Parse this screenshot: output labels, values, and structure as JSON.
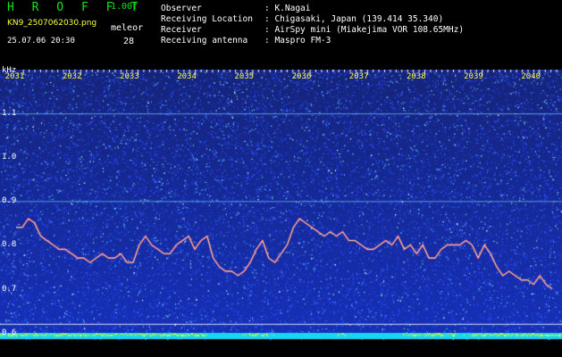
{
  "header": {
    "logo": "H R O F F T",
    "version": "1.00f",
    "filename": "KN9_2507062030.png",
    "timestamp": "25.07.06 20:30",
    "source_label": "meleor",
    "count": "28",
    "meta": [
      {
        "key": "Observer",
        "value": ": K.Nagai"
      },
      {
        "key": "Receiving Location",
        "value": ": Chigasaki, Japan (139.414 35.340)"
      },
      {
        "key": "Receiver",
        "value": ": AirSpy mini (Miakejima VOR 108.65MHz)"
      },
      {
        "key": "Receiving antenna",
        "value": ": Maspro FM-3"
      }
    ]
  },
  "colors": {
    "logo": "#13e51a",
    "file": "#ffff3c",
    "noise": "#1a2fc8",
    "trace": "#ff4e9a",
    "bar": "#ffff00",
    "base": "#17d6f2"
  },
  "chart_data": {
    "type": "heatmap",
    "ylabel": "kHz",
    "y_ticks": [
      "1.1",
      "1.0",
      "0.9",
      "0.8",
      "0.7",
      "0.6"
    ],
    "y_tick_values": [
      1.1,
      1.0,
      0.9,
      0.8,
      0.7,
      0.6
    ],
    "ylim": [
      0.585,
      1.2
    ],
    "x_ticks": [
      "2031",
      "2032",
      "2033",
      "2034",
      "2035",
      "2036",
      "2037",
      "2038",
      "2039",
      "2040"
    ],
    "xlim": [
      2030.6,
      2040.4
    ],
    "horizontal_lines_khz": [
      1.1,
      0.9,
      0.62
    ],
    "trace_khz": [
      0.84,
      0.84,
      0.86,
      0.85,
      0.82,
      0.81,
      0.8,
      0.79,
      0.79,
      0.78,
      0.77,
      0.77,
      0.76,
      0.77,
      0.78,
      0.77,
      0.77,
      0.78,
      0.76,
      0.76,
      0.8,
      0.82,
      0.8,
      0.79,
      0.78,
      0.78,
      0.8,
      0.81,
      0.82,
      0.79,
      0.81,
      0.82,
      0.77,
      0.75,
      0.74,
      0.74,
      0.73,
      0.74,
      0.76,
      0.79,
      0.81,
      0.77,
      0.76,
      0.78,
      0.8,
      0.84,
      0.86,
      0.85,
      0.84,
      0.83,
      0.82,
      0.83,
      0.82,
      0.83,
      0.81,
      0.81,
      0.8,
      0.79,
      0.79,
      0.8,
      0.81,
      0.8,
      0.82,
      0.79,
      0.8,
      0.78,
      0.8,
      0.77,
      0.77,
      0.79,
      0.8,
      0.8,
      0.8,
      0.81,
      0.8,
      0.77,
      0.8,
      0.78,
      0.75,
      0.73,
      0.74,
      0.73,
      0.72,
      0.72,
      0.71,
      0.73,
      0.71,
      0.7
    ]
  }
}
